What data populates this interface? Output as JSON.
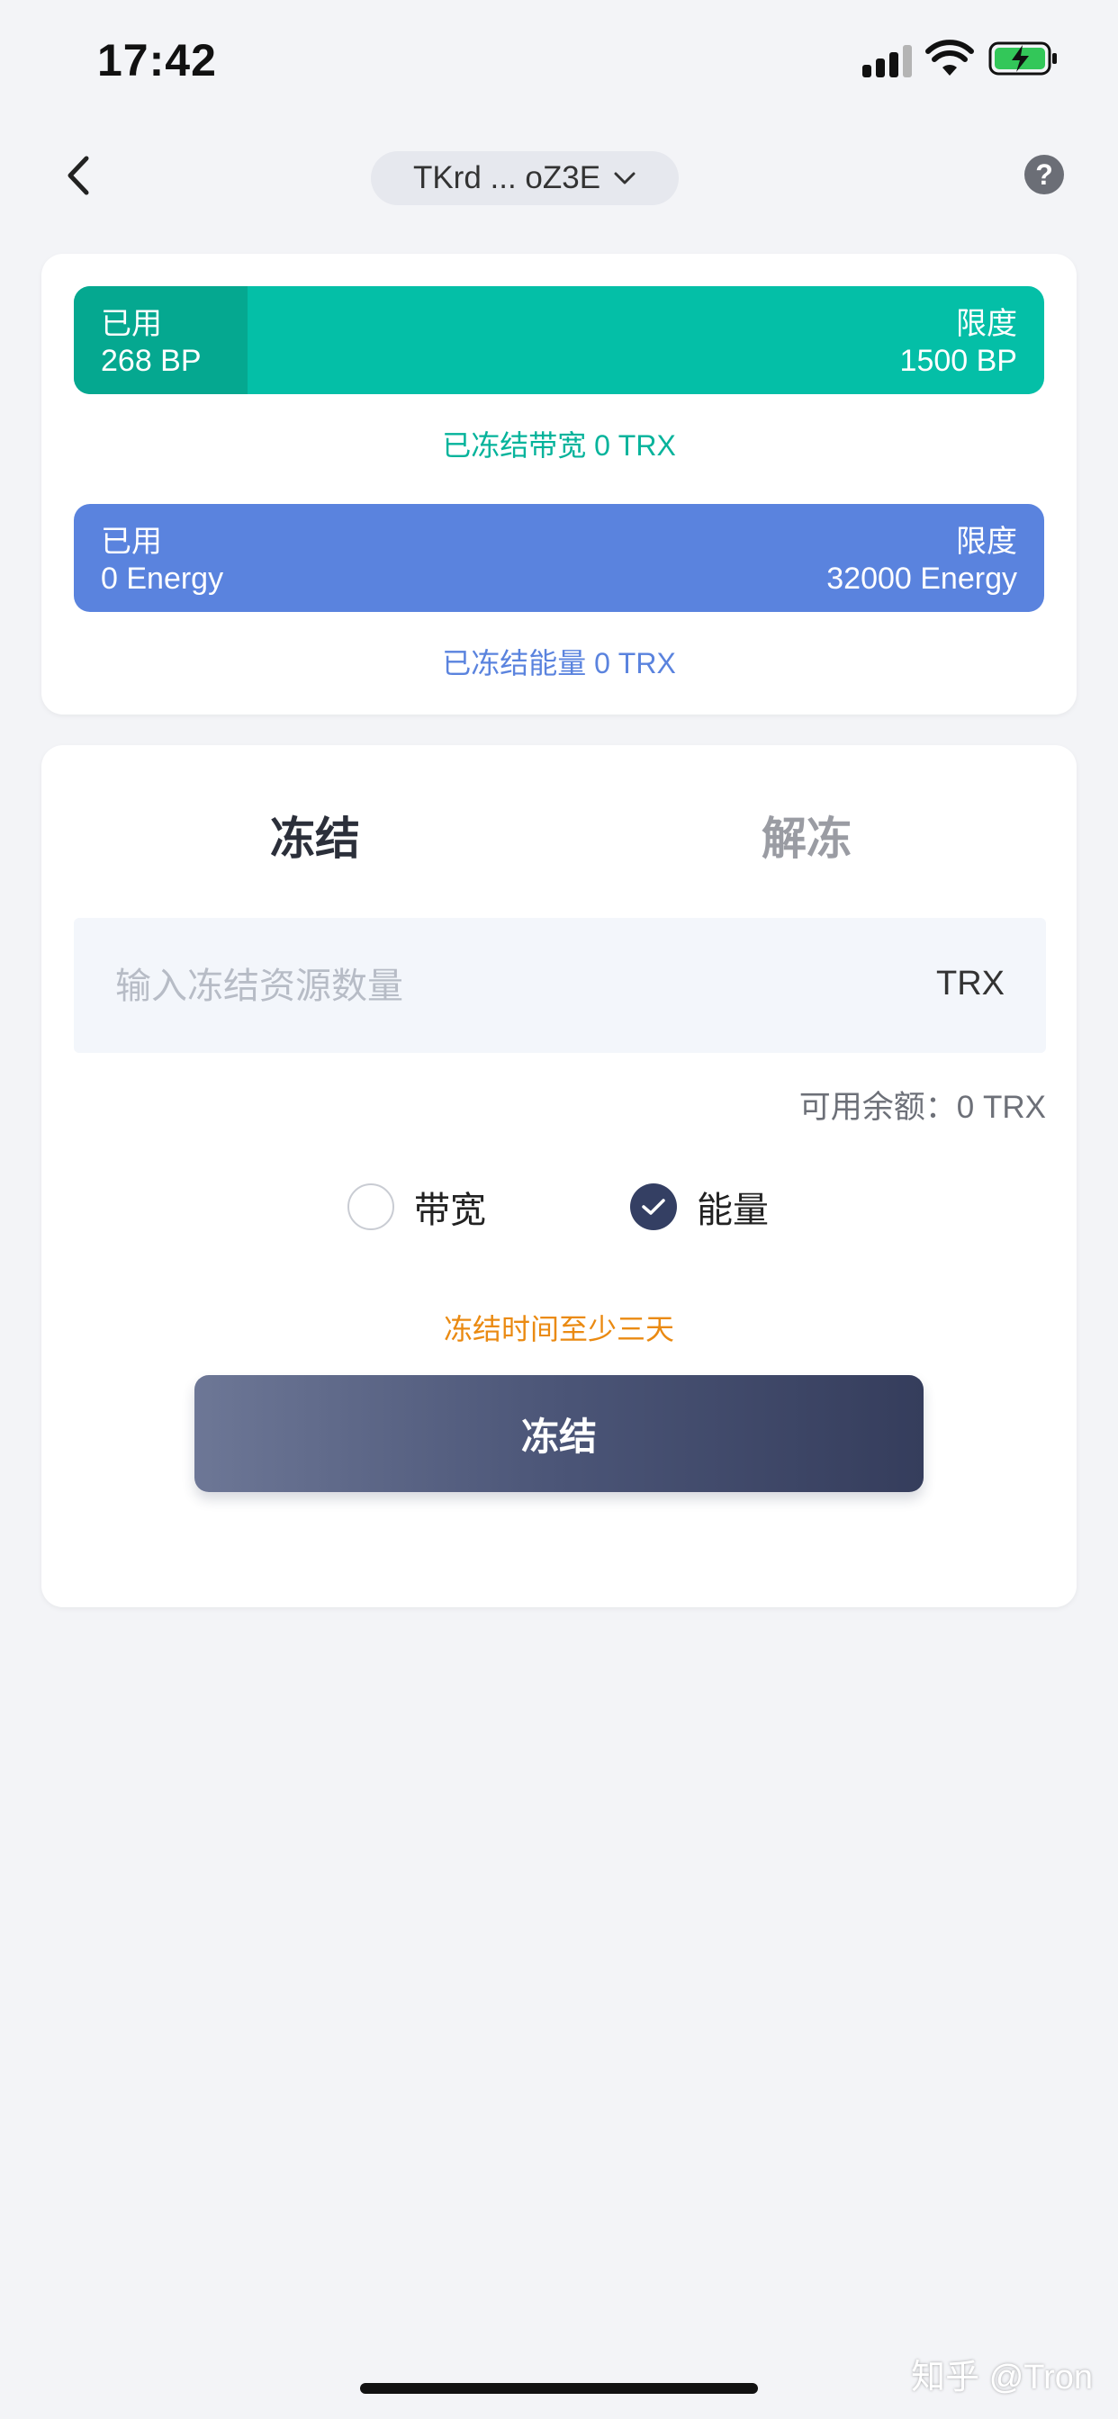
{
  "status_bar": {
    "time": "17:42"
  },
  "header": {
    "account": "TKrd ... oZ3E"
  },
  "bandwidth": {
    "used_label": "已用",
    "used_value": "268 BP",
    "limit_label": "限度",
    "limit_value": "1500 BP",
    "used_fraction": 0.179,
    "frozen_note": "已冻结带宽 0 TRX",
    "color": "#04bfa7"
  },
  "energy": {
    "used_label": "已用",
    "used_value": "0 Energy",
    "limit_label": "限度",
    "limit_value": "32000 Energy",
    "used_fraction": 0,
    "frozen_note": "已冻结能量 0 TRX",
    "color": "#5a83de"
  },
  "tabs": {
    "freeze": "冻结",
    "unfreeze": "解冻",
    "active": "freeze"
  },
  "form": {
    "amount_placeholder": "输入冻结资源数量",
    "amount_value": "",
    "unit": "TRX",
    "balance": "可用余额：0 TRX",
    "resource_options": [
      "带宽",
      "能量"
    ],
    "selected_resource": "能量",
    "hint": "冻结时间至少三天",
    "submit_label": "冻结"
  },
  "watermark": "知乎 @Tron",
  "colors": {
    "accent": "#343f63",
    "warning": "#ea8a12"
  }
}
